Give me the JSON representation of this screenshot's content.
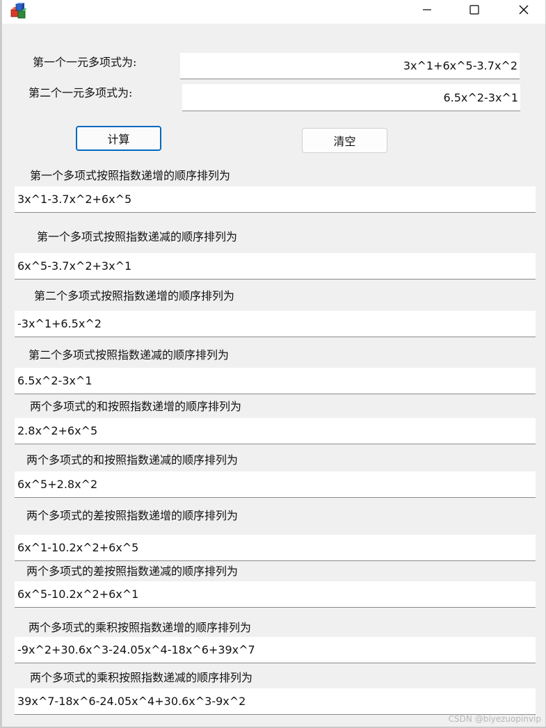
{
  "window": {
    "app_icon": "colored-cubes-icon"
  },
  "inputs": {
    "poly1_label": "第一个一元多项式为:",
    "poly1_value": "3x^1+6x^5-3.7x^2",
    "poly2_label": "第二个一元多项式为:",
    "poly2_value": "6.5x^2-3x^1"
  },
  "buttons": {
    "calculate": "计算",
    "clear": "清空"
  },
  "results": [
    {
      "label": "第一个多项式按照指数递增的顺序排列为",
      "value": "3x^1-3.7x^2+6x^5"
    },
    {
      "label": "第一个多项式按照指数递减的顺序排列为",
      "value": "6x^5-3.7x^2+3x^1"
    },
    {
      "label": "第二个多项式按照指数递增的顺序排列为",
      "value": "-3x^1+6.5x^2"
    },
    {
      "label": "第二个多项式按照指数递减的顺序排列为",
      "value": "6.5x^2-3x^1"
    },
    {
      "label": "两个多项式的和按照指数递增的顺序排列为",
      "value": "2.8x^2+6x^5"
    },
    {
      "label": "两个多项式的和按照指数递减的顺序排列为",
      "value": "6x^5+2.8x^2"
    },
    {
      "label": "两个多项式的差按照指数递增的顺序排列为",
      "value": "6x^1-10.2x^2+6x^5"
    },
    {
      "label": "两个多项式的差按照指数递减的顺序排列为",
      "value": "6x^5-10.2x^2+6x^1"
    },
    {
      "label": "两个多项式的乘积按照指数递增的顺序排列为",
      "value": "-9x^2+30.6x^3-24.05x^4-18x^6+39x^7"
    },
    {
      "label": "两个多项式的乘积按照指数递减的顺序排列为",
      "value": "39x^7-18x^6-24.05x^4+30.6x^3-9x^2"
    }
  ],
  "watermark": "CSDN @biyezuopinvip"
}
